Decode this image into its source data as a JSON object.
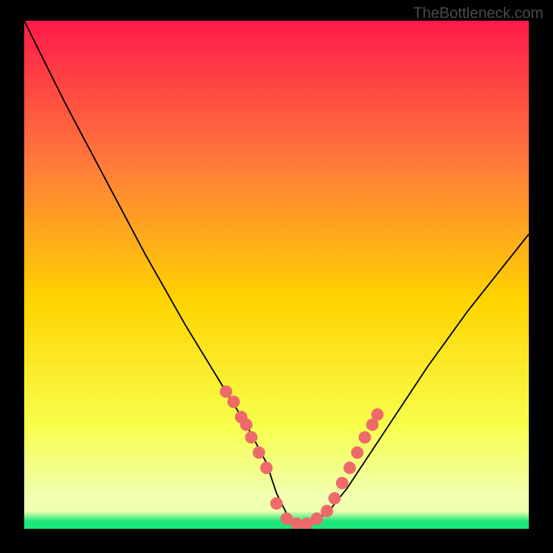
{
  "watermark": "TheBottleneck.com",
  "chart_data": {
    "type": "line",
    "title": "",
    "xlabel": "",
    "ylabel": "",
    "xlim": [
      0,
      100
    ],
    "ylim": [
      0,
      100
    ],
    "background_gradient": {
      "top": "#ff1a4a",
      "mid1": "#ff7a3a",
      "mid2": "#ffd400",
      "mid3": "#f7ff4d",
      "bottom_band": "#f0ffb0",
      "base": "#1de67a"
    },
    "series": [
      {
        "name": "bottleneck-curve",
        "color": "#000000",
        "x": [
          0,
          4,
          8,
          12,
          16,
          20,
          24,
          28,
          32,
          36,
          40,
          44,
          48,
          50,
          52,
          54,
          56,
          60,
          64,
          68,
          72,
          76,
          80,
          84,
          88,
          92,
          96,
          100
        ],
        "y": [
          100,
          92,
          84,
          76.5,
          69,
          61.5,
          54,
          47,
          40,
          33.5,
          27,
          20.5,
          13,
          7,
          3,
          1,
          1,
          3,
          8,
          14,
          20,
          26,
          32,
          37.5,
          43,
          48,
          53,
          58
        ]
      }
    ],
    "markers": {
      "name": "curve-points",
      "color": "#ee6a6a",
      "size": 9,
      "x": [
        40,
        41.5,
        43,
        44,
        45,
        46.5,
        48,
        50,
        52,
        54,
        56,
        58,
        60,
        61.5,
        63,
        64.5,
        66,
        67.5,
        69,
        70
      ],
      "y": [
        27,
        25,
        22,
        20.5,
        18,
        15,
        12,
        5,
        2,
        1,
        1,
        2,
        3.5,
        6,
        9,
        12,
        15,
        18,
        20.5,
        22.5
      ]
    }
  }
}
